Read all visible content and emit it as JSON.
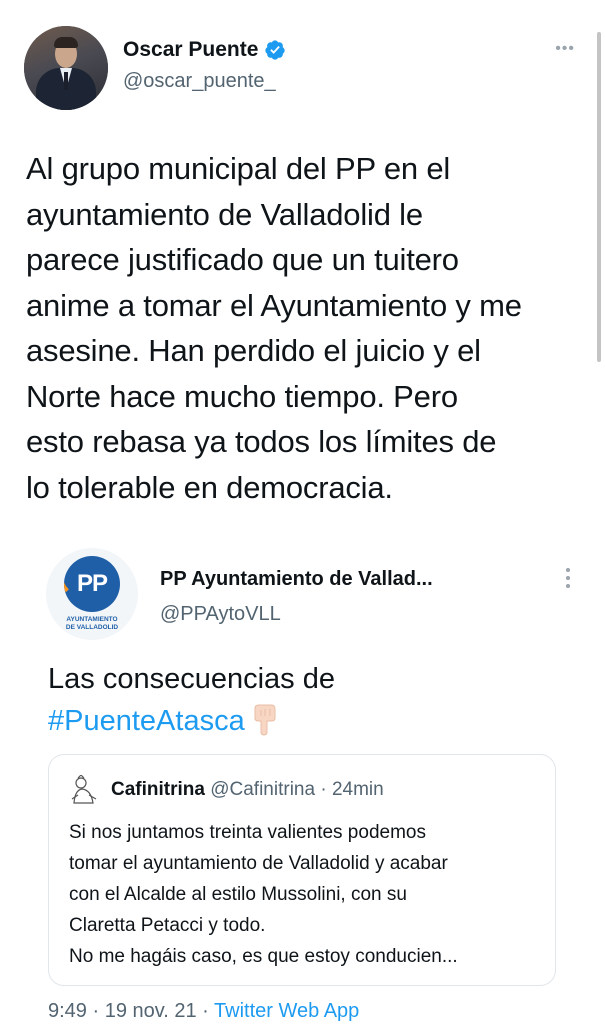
{
  "author": {
    "name": "Oscar Puente",
    "handle": "@oscar_puente_",
    "more_label": "•••"
  },
  "tweet": {
    "lines": [
      "Al grupo municipal del PP en el",
      "ayuntamiento de Valladolid le",
      "parece justificado que un tuitero",
      "anime a tomar el Ayuntamiento y me",
      "asesine. Han perdido el juicio y el",
      "Norte hace mucho tiempo. Pero",
      "esto rebasa ya todos los límites de",
      "lo tolerable en democracia."
    ]
  },
  "quoted": {
    "name": "PP Ayuntamiento de Vallad...",
    "handle": "@PPAytoVLL",
    "logo_text": "PP",
    "logo_caption_1": "AYUNTAMIENTO",
    "logo_caption_2": "DE VALLADOLID",
    "text_line1": "Las consecuencias de",
    "hashtag": "#PuenteAtasca",
    "nested": {
      "name": "Cafinitrina",
      "handle": "@Cafinitrina",
      "time": "· 24min",
      "lines": [
        "Si nos juntamos treinta valientes podemos",
        "tomar el ayuntamiento de Valladolid y acabar",
        "con el Alcalde al estilo Mussolini, con su",
        "Claretta Petacci y todo.",
        "No me hagáis caso, es que estoy conducien..."
      ]
    }
  },
  "footer": {
    "time": "9:49 · 19 nov. 21 · ",
    "source": "Twitter Web App"
  },
  "colors": {
    "accent": "#1d9bf0",
    "secondary_text": "#536471",
    "pp_blue": "#1f5fa8",
    "pp_orange": "#f7931e"
  },
  "icons": [
    "verified-badge-icon",
    "more-options-icon",
    "pointing-down-hand-icon",
    "cartoon-avatar-icon"
  ]
}
